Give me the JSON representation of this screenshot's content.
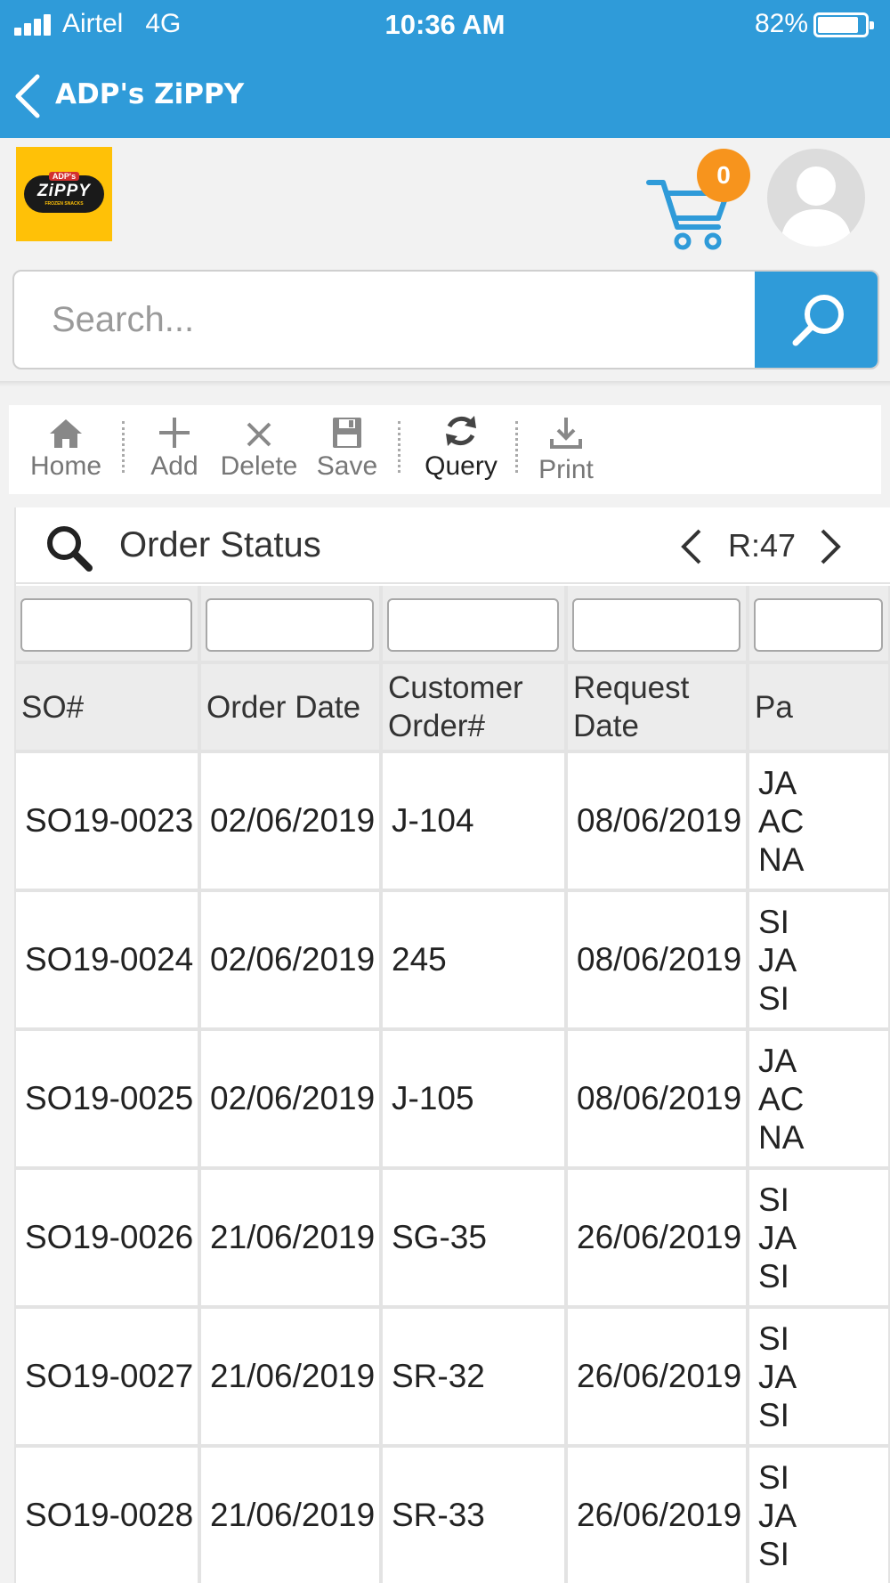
{
  "status_bar": {
    "carrier": "Airtel",
    "network": "4G",
    "time": "10:36 AM",
    "battery_percent": "82%"
  },
  "nav": {
    "title": "ADP's ZiPPY"
  },
  "logo": {
    "top_text": "ADP's",
    "main_text": "ZiPPY",
    "sub_text": "FROZEN SNACKS"
  },
  "cart": {
    "count": "0"
  },
  "search": {
    "placeholder": "Search..."
  },
  "toolbar": {
    "home": "Home",
    "add": "Add",
    "delete": "Delete",
    "save": "Save",
    "query": "Query",
    "print": "Print"
  },
  "grid": {
    "title": "Order Status",
    "record_count": "R:47",
    "columns": [
      "SO#",
      "Order Date",
      "Customer Order#",
      "Request Date",
      "Pa"
    ],
    "rows": [
      {
        "so": "SO19-0023",
        "order_date": "02/06/2019",
        "customer_order": "J-104",
        "request_date": "08/06/2019",
        "party": "JA AC NA"
      },
      {
        "so": "SO19-0024",
        "order_date": "02/06/2019",
        "customer_order": "245",
        "request_date": "08/06/2019",
        "party": "SI JA SI"
      },
      {
        "so": "SO19-0025",
        "order_date": "02/06/2019",
        "customer_order": "J-105",
        "request_date": "08/06/2019",
        "party": "JA AC NA"
      },
      {
        "so": "SO19-0026",
        "order_date": "21/06/2019",
        "customer_order": "SG-35",
        "request_date": "26/06/2019",
        "party": "SI JA SI"
      },
      {
        "so": "SO19-0027",
        "order_date": "21/06/2019",
        "customer_order": "SR-32",
        "request_date": "26/06/2019",
        "party": "SI JA SI"
      },
      {
        "so": "SO19-0028",
        "order_date": "21/06/2019",
        "customer_order": "SR-33",
        "request_date": "26/06/2019",
        "party": "SI JA SI"
      }
    ]
  },
  "colors": {
    "primary": "#2f9bd9",
    "badge": "#f7941d",
    "logo_bg": "#ffc107"
  }
}
